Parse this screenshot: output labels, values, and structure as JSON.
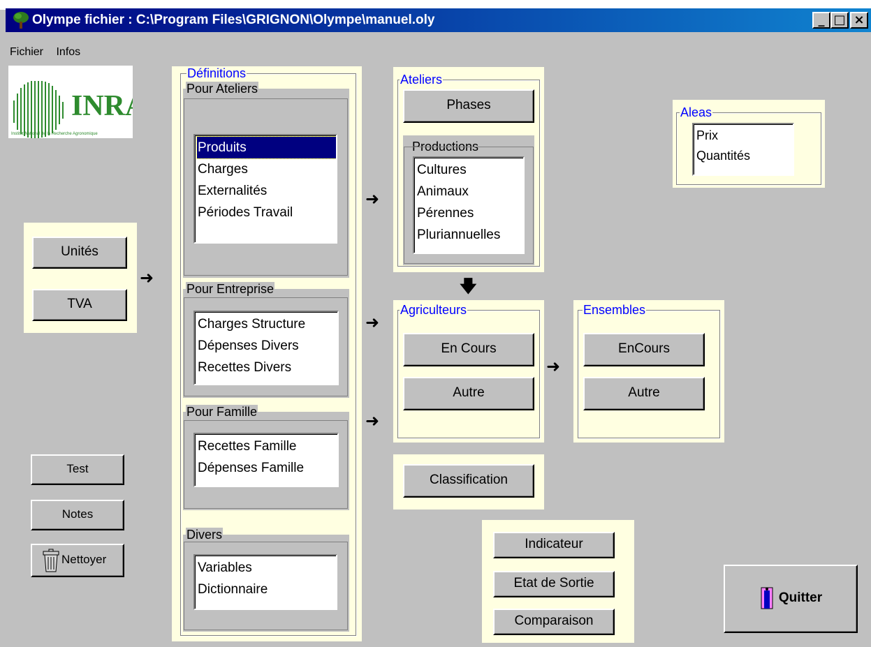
{
  "window": {
    "title": "Olympe  fichier : C:\\Program Files\\GRIGNON\\Olympe\\manuel.oly"
  },
  "menu": {
    "items": [
      "Fichier",
      "Infos"
    ]
  },
  "logo": {
    "text": "INRA",
    "subtitle": "Institut National de la Recherche Agronomique"
  },
  "left_panel": {
    "unites": "Unités",
    "tva": "TVA"
  },
  "definitions": {
    "title": "Définitions",
    "pour_ateliers": {
      "title": "Pour Ateliers",
      "items": [
        "Produits",
        "Charges",
        "Externalités",
        "Périodes Travail"
      ],
      "selected": "Produits"
    },
    "pour_entreprise": {
      "title": "Pour Entreprise",
      "items": [
        "Charges  Structure",
        "Dépenses Divers",
        "Recettes  Divers"
      ]
    },
    "pour_famille": {
      "title": "Pour Famille",
      "items": [
        "Recettes Famille",
        "Dépenses Famille"
      ]
    },
    "divers": {
      "title": "Divers",
      "items": [
        "Variables",
        "Dictionnaire"
      ]
    }
  },
  "ateliers": {
    "title": "Ateliers",
    "phases": "Phases",
    "productions_title": "Productions",
    "productions": [
      "Cultures",
      "Animaux",
      "Pérennes",
      "Pluriannuelles"
    ]
  },
  "agriculteurs": {
    "title": "Agriculteurs",
    "en_cours": "En Cours",
    "autre": "Autre"
  },
  "ensembles": {
    "title": "Ensembles",
    "en_cours": "EnCours",
    "autre": "Autre"
  },
  "aleas": {
    "title": "Aleas",
    "items": [
      "Prix",
      "Quantités"
    ]
  },
  "classification": "Classification",
  "outputs": {
    "indicateur": "Indicateur",
    "etat_sortie": "Etat de Sortie",
    "comparaison": "Comparaison"
  },
  "bottom_left": {
    "test": "Test",
    "notes": "Notes",
    "nettoyer": "Nettoyer"
  },
  "quitter": "Quitter",
  "colors": {
    "title_bar": "#000080",
    "panel": "#ffffe1",
    "selection": "#000080",
    "group_title": "#0000ff",
    "background": "#c0c0c0"
  }
}
